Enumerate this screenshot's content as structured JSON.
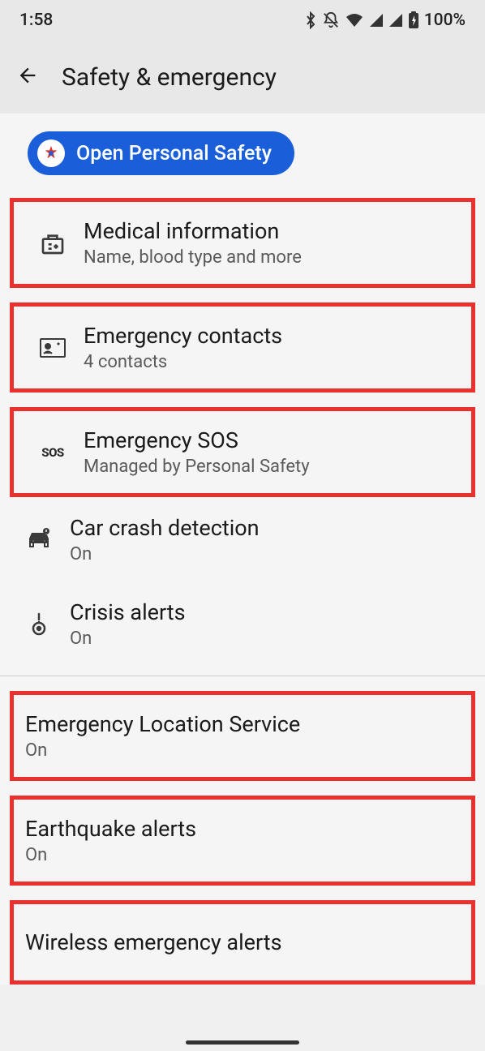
{
  "status": {
    "time": "1:58",
    "battery": "100%"
  },
  "header": {
    "title": "Safety & emergency"
  },
  "pill": {
    "label": "Open Personal Safety"
  },
  "items": {
    "medical": {
      "title": "Medical information",
      "subtitle": "Name, blood type and more"
    },
    "contacts": {
      "title": "Emergency contacts",
      "subtitle": "4 contacts"
    },
    "sos": {
      "title": "Emergency SOS",
      "subtitle": "Managed by Personal Safety",
      "icon_text": "SOS"
    },
    "crash": {
      "title": "Car crash detection",
      "subtitle": "On"
    },
    "crisis": {
      "title": "Crisis alerts",
      "subtitle": "On"
    },
    "els": {
      "title": "Emergency Location Service",
      "subtitle": "On"
    },
    "earthquake": {
      "title": "Earthquake alerts",
      "subtitle": "On"
    },
    "wireless": {
      "title": "Wireless emergency alerts"
    }
  }
}
